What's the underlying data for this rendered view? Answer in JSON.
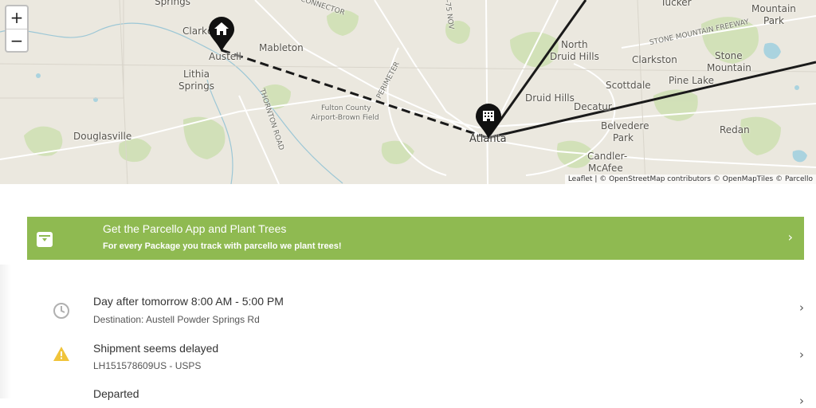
{
  "map": {
    "zoom_in_label": "+",
    "zoom_out_label": "−",
    "attribution": "Leaflet | © OpenStreetMap contributors © OpenMapTiles © Parcello",
    "labels": [
      {
        "text": "Springs",
        "cls": ""
      },
      {
        "text": "Clarkdale",
        "cls": ""
      },
      {
        "text": "Austell",
        "cls": ""
      },
      {
        "text": "Mableton",
        "cls": ""
      },
      {
        "text": "Lithia",
        "cls": ""
      },
      {
        "text": "Springs",
        "cls": ""
      },
      {
        "text": "Douglasville",
        "cls": ""
      },
      {
        "text": "Fulton County",
        "cls": "small"
      },
      {
        "text": "Airport-Brown Field",
        "cls": "small"
      },
      {
        "text": "PERIMETER",
        "cls": "small"
      },
      {
        "text": "THORNTON ROAD",
        "cls": "small"
      },
      {
        "text": "CONNECTOR",
        "cls": "small"
      },
      {
        "text": "I-75 NOV",
        "cls": "small"
      },
      {
        "text": "North",
        "cls": ""
      },
      {
        "text": "Druid Hills",
        "cls": ""
      },
      {
        "text": "Druid Hills",
        "cls": ""
      },
      {
        "text": "Clarkston",
        "cls": ""
      },
      {
        "text": "Tucker",
        "cls": ""
      },
      {
        "text": "Mountain",
        "cls": ""
      },
      {
        "text": "Park",
        "cls": ""
      },
      {
        "text": "STONE MOUNTAIN FREEWAY",
        "cls": "small"
      },
      {
        "text": "Stone",
        "cls": ""
      },
      {
        "text": "Mountain",
        "cls": ""
      },
      {
        "text": "Scottdale",
        "cls": ""
      },
      {
        "text": "Pine Lake",
        "cls": ""
      },
      {
        "text": "Decatur",
        "cls": ""
      },
      {
        "text": "Belvedere",
        "cls": ""
      },
      {
        "text": "Park",
        "cls": ""
      },
      {
        "text": "Redan",
        "cls": ""
      },
      {
        "text": "Candler-",
        "cls": ""
      },
      {
        "text": "McAfee",
        "cls": ""
      },
      {
        "text": "Atlanta",
        "cls": "big"
      }
    ]
  },
  "promo": {
    "title": "Get the Parcello App and Plant Trees",
    "subtitle": "For every Package you track with parcello we plant trees!"
  },
  "events": [
    {
      "title": "Day after tomorrow 8:00 AM - 5:00 PM",
      "subtitle": "Destination: Austell Powder Springs Rd",
      "icon": "clock-icon"
    },
    {
      "title": "Shipment seems delayed",
      "subtitle": "LH151578609US - USPS",
      "icon": "warning-icon"
    },
    {
      "title": "Departed",
      "subtitle": "",
      "icon": "departed-icon"
    }
  ],
  "colors": {
    "promo_green": "#8fba51",
    "warning_yellow": "#f0c43a",
    "route_line": "#1a1a1a"
  }
}
